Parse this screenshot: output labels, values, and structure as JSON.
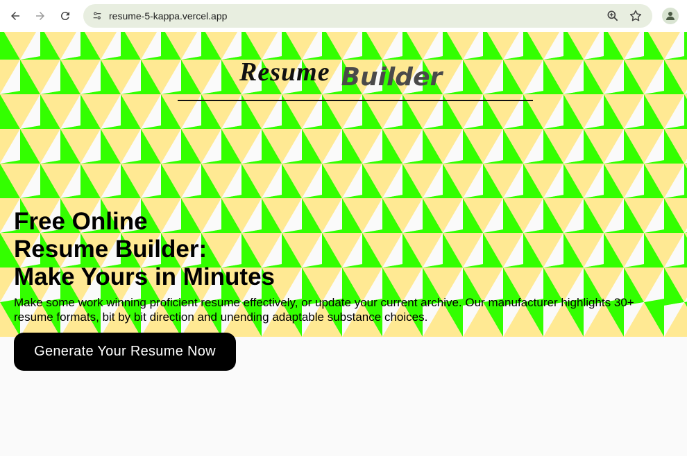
{
  "browser": {
    "url": "resume-5-kappa.vercel.app",
    "icons": {
      "back": "arrow-left-icon",
      "forward": "arrow-right-icon",
      "reload": "reload-icon",
      "site_info": "tune-icon",
      "zoom": "zoom-in-icon",
      "bookmark": "star-icon",
      "profile": "person-icon"
    }
  },
  "page": {
    "logo": {
      "script_word": "Resume",
      "bold_word": "Builder"
    },
    "hero": {
      "title_lines": [
        "Free Online",
        "Resume Builder:",
        "Make Yours in Minutes"
      ],
      "description": "Make some work winning proficient resume effectively, or update your current archive. Our manufacturer highlights 30+ resume formats, bit by bit direction and unending adaptable substance choices.",
      "cta_label": "Generate Your Resume Now"
    },
    "colors": {
      "pattern_green": "#33ff00",
      "pattern_yellow": "#ffe993",
      "pattern_white": "#fafafa",
      "cta_bg": "#000000",
      "cta_text": "#ffffff"
    }
  }
}
